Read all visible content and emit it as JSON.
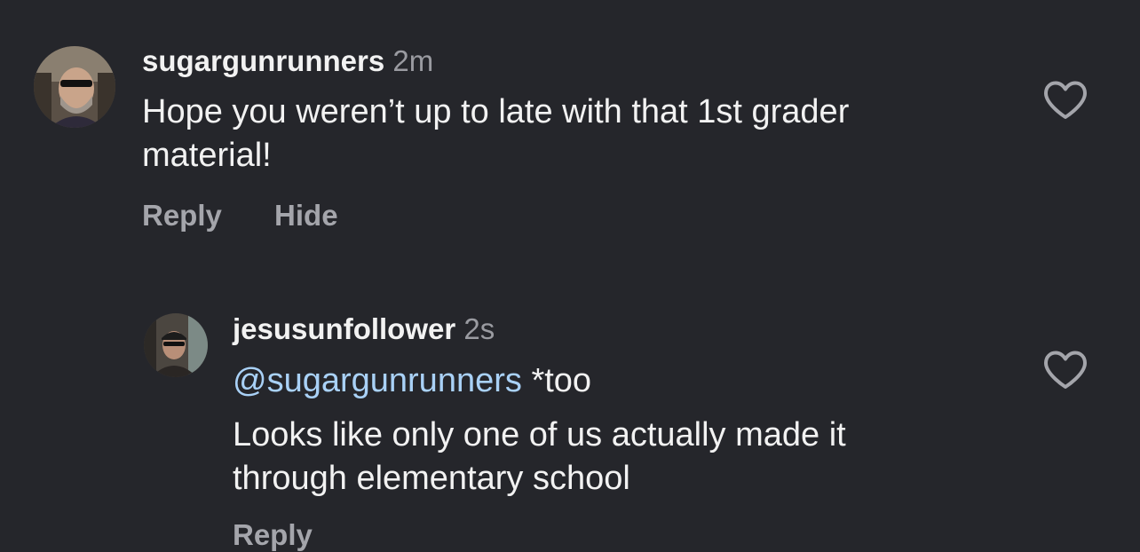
{
  "comments": [
    {
      "username": "sugargunrunners",
      "time": "2m",
      "text_line1": "Hope you weren’t up to late with that 1st grader",
      "text_line2": "material!",
      "reply_label": "Reply",
      "hide_label": "Hide",
      "avatar_icon": "user-avatar-photo",
      "like_icon": "heart-outline-icon"
    },
    {
      "username": "jesusunfollower",
      "time": "2s",
      "mention": "@sugargunrunners",
      "mention_suffix": " *too",
      "text_line1": "Looks like only one of us actually made it",
      "text_line2": "through elementary school",
      "reply_label": "Reply",
      "avatar_icon": "user-avatar-photo",
      "like_icon": "heart-outline-icon"
    }
  ],
  "colors": {
    "background": "#25262b",
    "text": "#f2f2f2",
    "secondary": "#9a9ba1",
    "mention": "#a9d1f7"
  }
}
